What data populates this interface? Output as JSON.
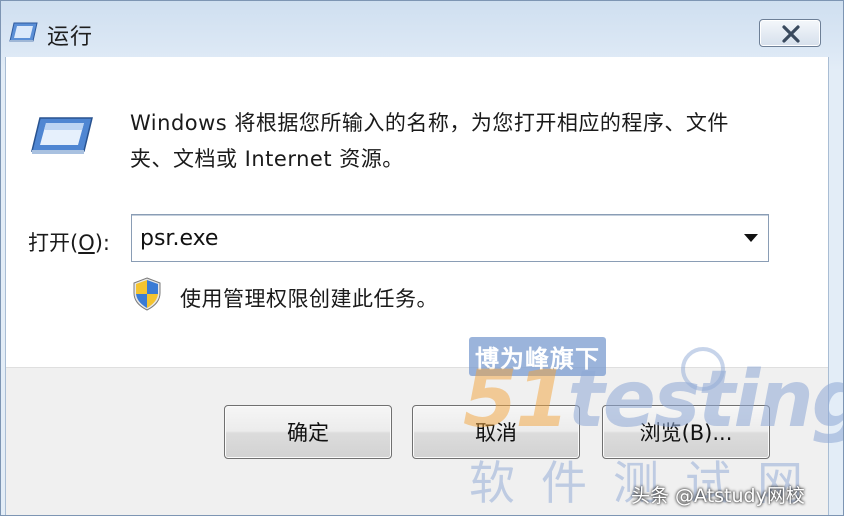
{
  "window": {
    "title": "运行",
    "title_icon": "run-icon",
    "close_icon": "close-icon"
  },
  "dialog": {
    "prompt": "Windows 将根据您所输入的名称，为您打开相应的程序、文件夹、文档或 Internet 资源。",
    "open_label_prefix": "打开(",
    "open_label_mnemonic": "O",
    "open_label_suffix": "):",
    "open_value": "psr.exe",
    "admin_note": "使用管理权限创建此任务。",
    "shield_icon": "uac-shield-icon"
  },
  "buttons": {
    "ok": "确定",
    "cancel": "取消",
    "browse": "浏览(B)..."
  },
  "watermark": {
    "badge": "博为峰旗下",
    "logo_five": "51",
    "logo_rest": "testing",
    "school": "软件测试网",
    "credit": "头条 @Atstudy网校"
  },
  "colors": {
    "accent": "#7a9bd0",
    "logo_orange": "#f2a33a"
  }
}
